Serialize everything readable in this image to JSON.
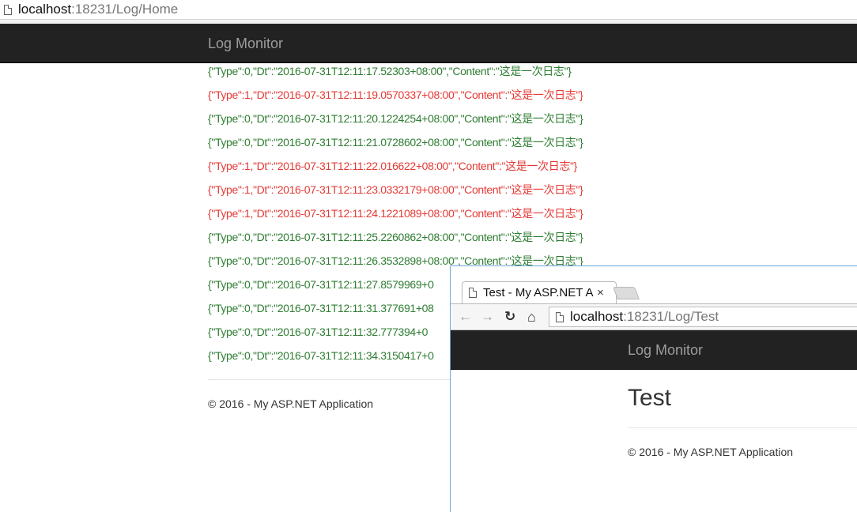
{
  "main_window": {
    "address": {
      "host": "localhost",
      "rest": ":18231/Log/Home"
    },
    "brand": "Log Monitor",
    "log_lines": [
      {
        "type": 0,
        "text": "{\"Type\":0,\"Dt\":\"2016-07-31T12:11:17.52303+08:00\",\"Content\":\"这是一次日志\"}"
      },
      {
        "type": 1,
        "text": "{\"Type\":1,\"Dt\":\"2016-07-31T12:11:19.0570337+08:00\",\"Content\":\"这是一次日志\"}"
      },
      {
        "type": 0,
        "text": "{\"Type\":0,\"Dt\":\"2016-07-31T12:11:20.1224254+08:00\",\"Content\":\"这是一次日志\"}"
      },
      {
        "type": 0,
        "text": "{\"Type\":0,\"Dt\":\"2016-07-31T12:11:21.0728602+08:00\",\"Content\":\"这是一次日志\"}"
      },
      {
        "type": 1,
        "text": "{\"Type\":1,\"Dt\":\"2016-07-31T12:11:22.016622+08:00\",\"Content\":\"这是一次日志\"}"
      },
      {
        "type": 1,
        "text": "{\"Type\":1,\"Dt\":\"2016-07-31T12:11:23.0332179+08:00\",\"Content\":\"这是一次日志\"}"
      },
      {
        "type": 1,
        "text": "{\"Type\":1,\"Dt\":\"2016-07-31T12:11:24.1221089+08:00\",\"Content\":\"这是一次日志\"}"
      },
      {
        "type": 0,
        "text": "{\"Type\":0,\"Dt\":\"2016-07-31T12:11:25.2260862+08:00\",\"Content\":\"这是一次日志\"}"
      },
      {
        "type": 0,
        "text": "{\"Type\":0,\"Dt\":\"2016-07-31T12:11:26.3532898+08:00\",\"Content\":\"这是一次日志\"}"
      },
      {
        "type": 0,
        "text": "{\"Type\":0,\"Dt\":\"2016-07-31T12:11:27.8579969+0"
      },
      {
        "type": 0,
        "text": "{\"Type\":0,\"Dt\":\"2016-07-31T12:11:31.377691+08"
      },
      {
        "type": 0,
        "text": "{\"Type\":0,\"Dt\":\"2016-07-31T12:11:32.777394+0"
      },
      {
        "type": 0,
        "text": "{\"Type\":0,\"Dt\":\"2016-07-31T12:11:34.3150417+0"
      }
    ],
    "footer": "© 2016 - My ASP.NET Application"
  },
  "popup_window": {
    "tab_title": "Test - My ASP.NET A",
    "tab_close": "×",
    "nav": {
      "back": "←",
      "forward": "→",
      "reload": "↻",
      "home": "⌂"
    },
    "address": {
      "host": "localhost",
      "rest": ":18231/Log/Test"
    },
    "brand": "Log Monitor",
    "heading": "Test",
    "footer": "© 2016 - My ASP.NET Application"
  },
  "colors": {
    "type0": "#2e7d32",
    "type1": "#e53935",
    "navbar": "#222222",
    "brand": "#9d9d9d"
  },
  "icons": [
    "page-icon",
    "back-arrow-icon",
    "forward-arrow-icon",
    "reload-icon",
    "home-icon",
    "close-icon"
  ]
}
